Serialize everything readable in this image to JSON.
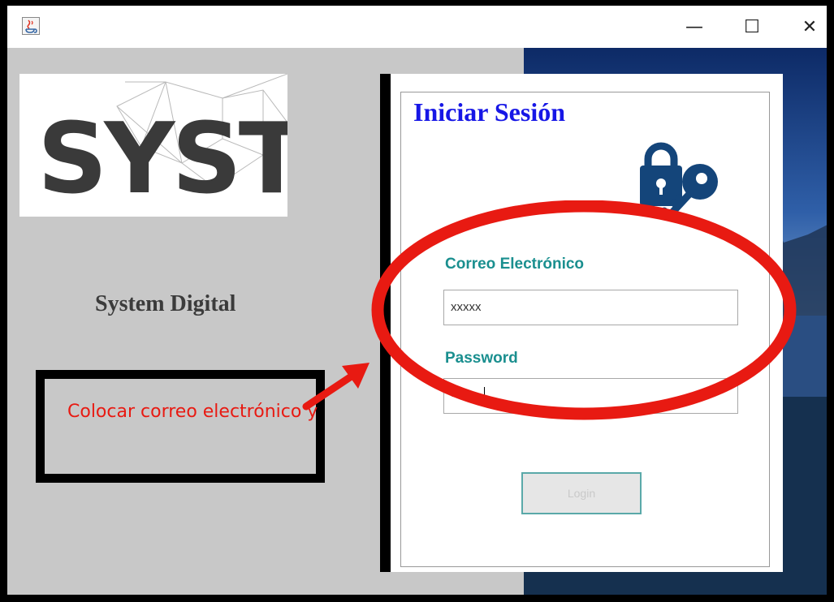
{
  "window": {
    "controls": {
      "minimize": "—",
      "maximize": "☐",
      "close": "✕"
    }
  },
  "left": {
    "logo_text": "SYST",
    "brand": "System Digital",
    "note": "Colocar correo electrónico y"
  },
  "login": {
    "legend": "Iniciar Sesión",
    "email_label": "Correo Electrónico",
    "email_value": "xxxxx",
    "password_label": "Password",
    "password_value": "••••••",
    "login_button": "Login"
  },
  "icons": [
    "java-app-icon",
    "lock-key-icon"
  ],
  "colors": {
    "legend": "#1717e6",
    "labels": "#1a8f8f",
    "annotation": "#e81a12",
    "button_border": "#5aa9a9"
  }
}
